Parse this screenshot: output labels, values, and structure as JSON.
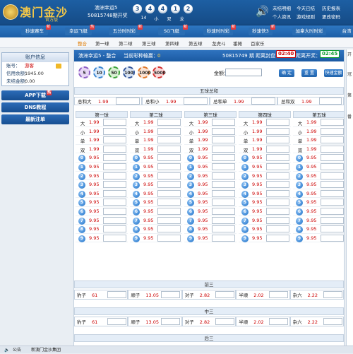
{
  "header": {
    "brand": "澳门金沙",
    "brand_sub": "官方版",
    "lottery_name": "澳洲幸运5",
    "period_text": "50815748期开奖",
    "balls": [
      "3",
      "4",
      "4",
      "1",
      "2"
    ],
    "ball_stats": [
      "14",
      "小",
      "双",
      "龙"
    ],
    "links": {
      "unsettled": "未结明细",
      "today": "今天已结",
      "history": "历史报表",
      "profile": "个人资讯",
      "rules": "游戏规则",
      "password": "更改密码"
    }
  },
  "nav": {
    "items": [
      {
        "label": "秒速赛车",
        "hot": "新"
      },
      {
        "label": "幸运飞艇",
        "hot": "热"
      },
      {
        "label": "五分时时彩",
        "hot": "新"
      },
      {
        "label": "SG飞艇",
        "hot": "新"
      },
      {
        "label": "秒速时时彩",
        "hot": "新"
      },
      {
        "label": "秒速快3",
        "hot": "新"
      },
      {
        "label": "加拿大时时彩",
        "hot": ""
      },
      {
        "label": "台湾",
        "hot": ""
      }
    ]
  },
  "subnav": [
    "整合",
    "第一球",
    "第二球",
    "第三球",
    "第四球",
    "第五球",
    "龙虎斗",
    "番摊",
    "百家乐"
  ],
  "sidebar": {
    "account_title": "账户信息",
    "account_label": "账号：",
    "account_value": "游客",
    "credit_label": "信用余额：",
    "credit_value": "1945.00",
    "unsettled_label": "未结金额：",
    "unsettled_value": "0.00",
    "buttons": [
      {
        "label": "APP下载",
        "hot": "热"
      },
      {
        "label": "DNS教程",
        "hot": ""
      },
      {
        "label": "最新注单",
        "hot": ""
      }
    ]
  },
  "main": {
    "info": {
      "game": "澳洲幸运5 - 整合",
      "play_label": "当前彩种输赢：",
      "play_value": "0",
      "period": "50815749 期 距离封盘：",
      "close_timer": "02:40",
      "open_label": "距离开奖：",
      "open_timer": "02:45"
    },
    "chips": [
      "5",
      "10",
      "50",
      "100",
      "1000",
      "5000"
    ],
    "amount_label": "金额：",
    "buttons": {
      "confirm": "确 定",
      "reset": "重 置",
      "fast": "快速金额"
    },
    "sum_title": "五球总和",
    "sum_items": [
      {
        "label": "总和大",
        "odds": "1.99"
      },
      {
        "label": "总和小",
        "odds": "1.99"
      },
      {
        "label": "总和单",
        "odds": "1.99"
      },
      {
        "label": "总和双",
        "odds": "1.99"
      }
    ],
    "columns": [
      {
        "title": "第一球"
      },
      {
        "title": "第二球"
      },
      {
        "title": "第三球"
      },
      {
        "title": "第四球"
      },
      {
        "title": "第五球"
      }
    ],
    "bs_rows": [
      {
        "label": "大",
        "odds": "1.99"
      },
      {
        "label": "小",
        "odds": "1.99"
      },
      {
        "label": "单",
        "odds": "1.99"
      },
      {
        "label": "双",
        "odds": "1.99"
      }
    ],
    "num_rows": [
      {
        "label": "0",
        "odds": "9.95"
      },
      {
        "label": "1",
        "odds": "9.95"
      },
      {
        "label": "2",
        "odds": "9.95"
      },
      {
        "label": "3",
        "odds": "9.95"
      },
      {
        "label": "4",
        "odds": "9.95"
      },
      {
        "label": "5",
        "odds": "9.95"
      },
      {
        "label": "6",
        "odds": "9.95"
      },
      {
        "label": "7",
        "odds": "9.95"
      },
      {
        "label": "8",
        "odds": "9.95"
      },
      {
        "label": "9",
        "odds": "9.95"
      }
    ],
    "front3_title": "前三",
    "mid3_title": "中三",
    "back3_title": "后三",
    "combo_items": [
      {
        "label": "豹子",
        "odds": "61"
      },
      {
        "label": "顺子",
        "odds": "13.05"
      },
      {
        "label": "对子",
        "odds": "2.82"
      },
      {
        "label": "半顺",
        "odds": "2.02"
      },
      {
        "label": "杂六",
        "odds": "2.22"
      }
    ]
  },
  "right_rail": [
    "开",
    "冠",
    "第",
    "番"
  ],
  "footer": {
    "label": "公告",
    "text": "新澳门金沙集团"
  },
  "colors": {
    "brand": "#1d5fa3",
    "gold": "#f0c64a",
    "odds": "#c00",
    "timer_green": "#0a9d2e"
  }
}
